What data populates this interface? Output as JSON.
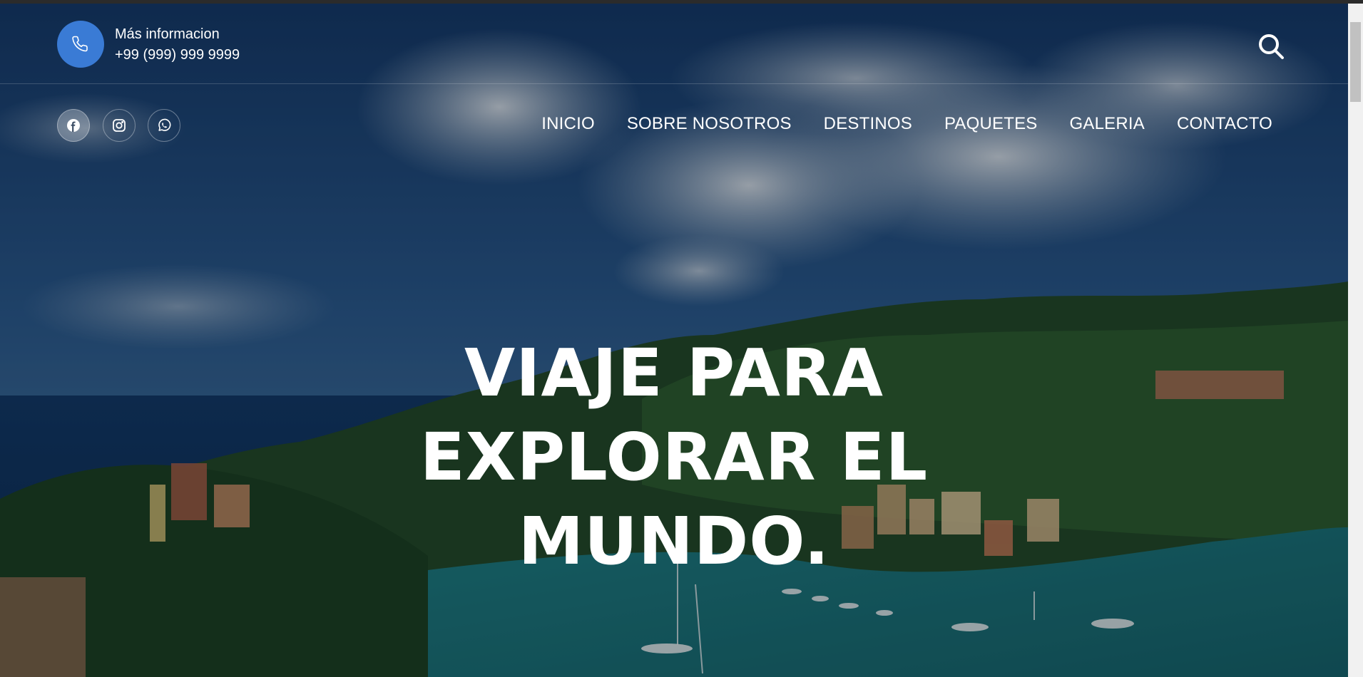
{
  "header": {
    "contact_label": "Más informacion",
    "contact_phone": "+99 (999) 999 9999",
    "phone_icon": "phone-icon",
    "search_icon": "search-icon"
  },
  "social": {
    "items": [
      {
        "name": "facebook",
        "icon": "facebook-icon"
      },
      {
        "name": "instagram",
        "icon": "instagram-icon"
      },
      {
        "name": "whatsapp",
        "icon": "whatsapp-icon"
      }
    ]
  },
  "nav": {
    "items": [
      {
        "label": "INICIO"
      },
      {
        "label": "SOBRE NOSOTROS"
      },
      {
        "label": "DESTINOS"
      },
      {
        "label": "PAQUETES"
      },
      {
        "label": "GALERIA"
      },
      {
        "label": "CONTACTO"
      }
    ]
  },
  "hero": {
    "title_lines": [
      "VIAJE PARA",
      "EXPLORAR EL",
      "MUNDO."
    ]
  },
  "colors": {
    "accent": "#3a7bd5",
    "text": "#ffffff"
  }
}
